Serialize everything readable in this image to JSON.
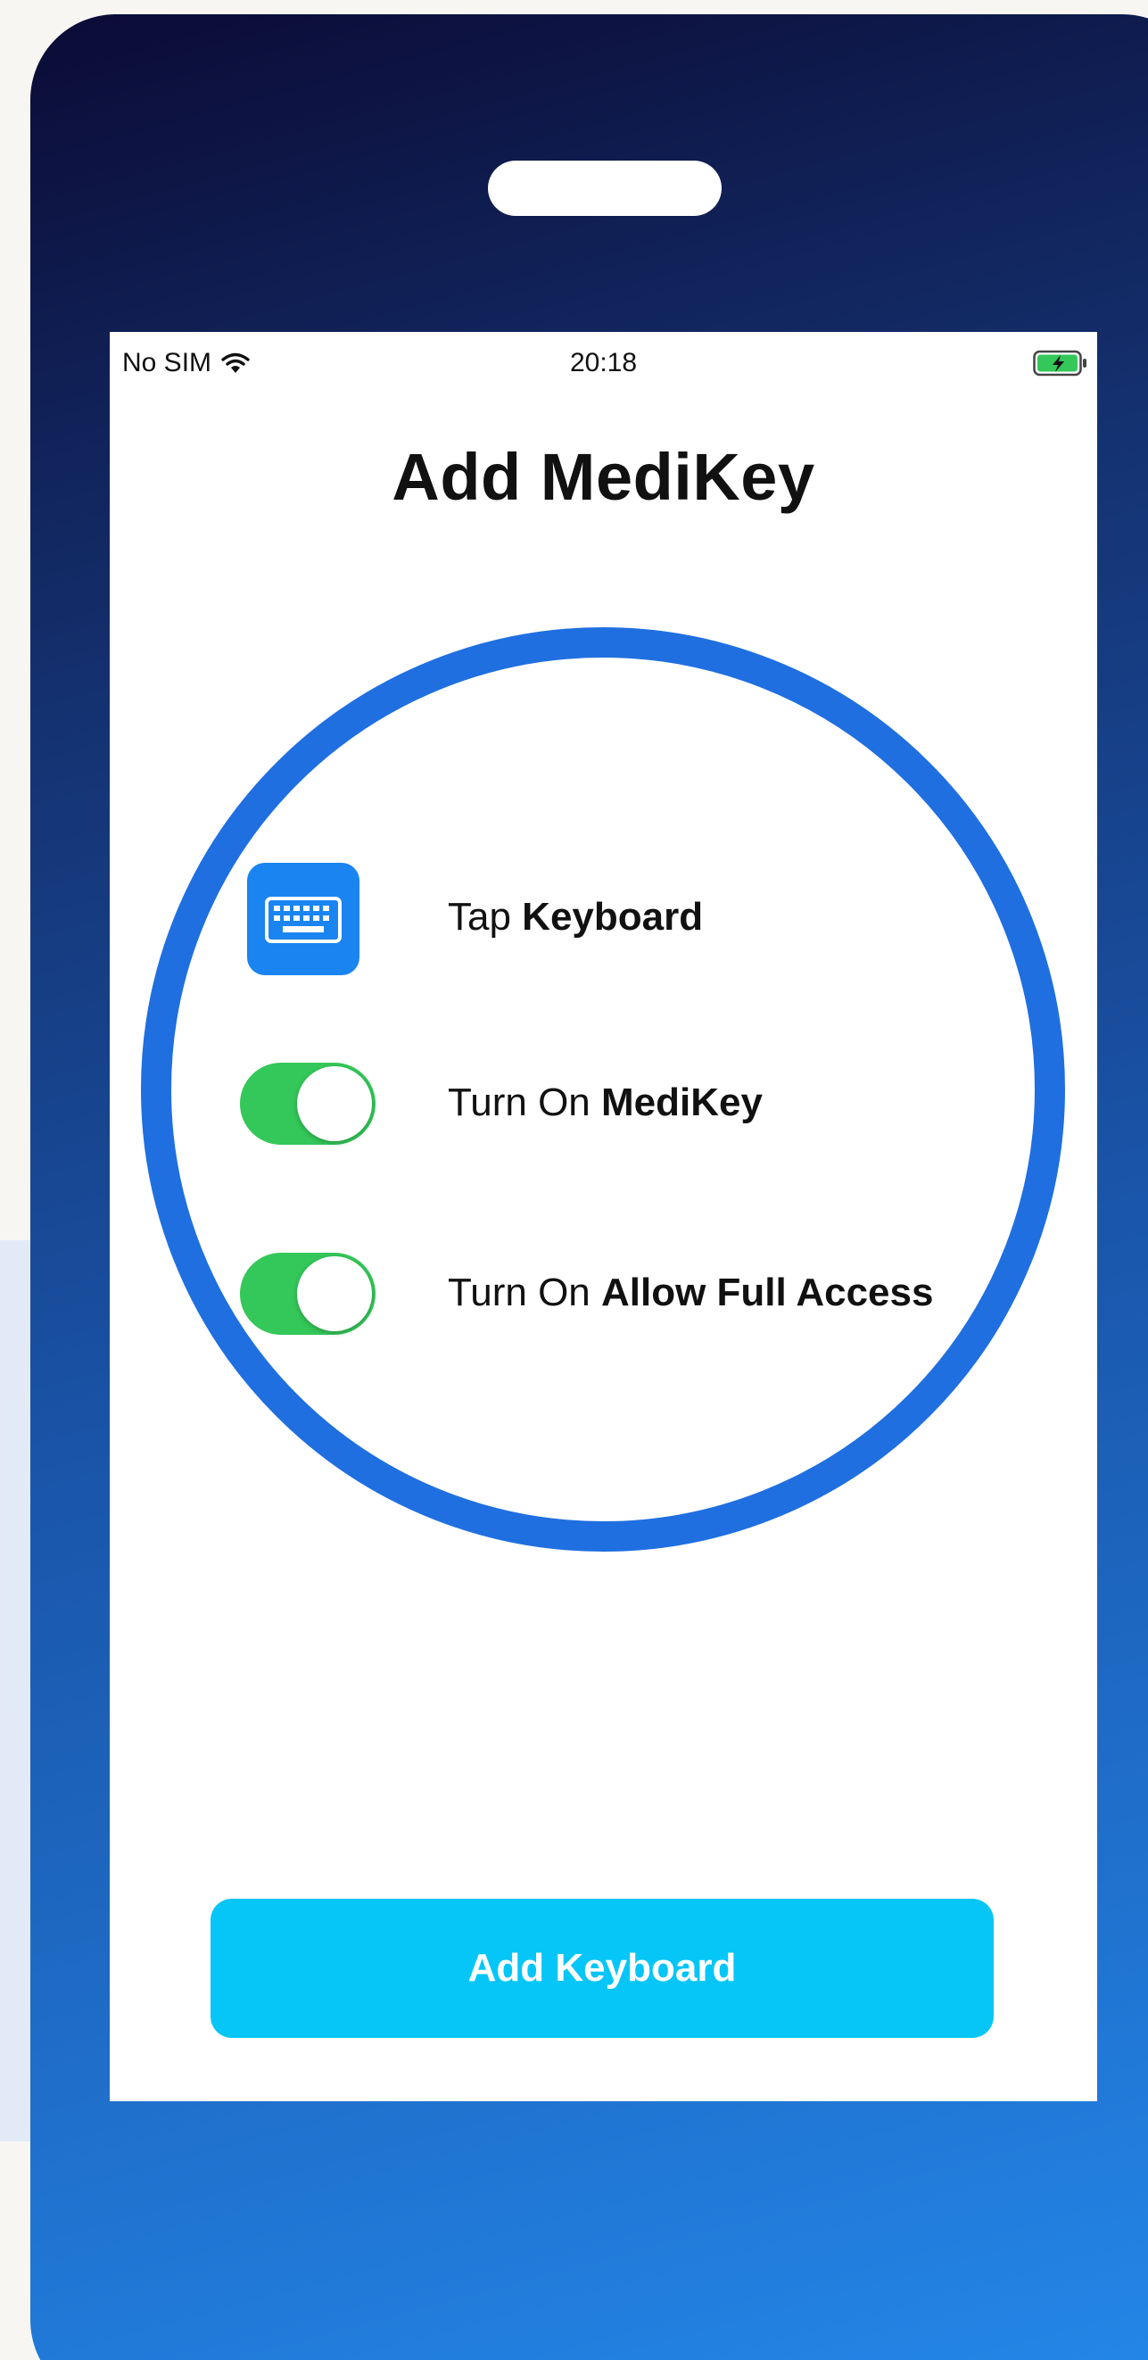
{
  "status_bar": {
    "carrier": "No SIM",
    "time": "20:18"
  },
  "screen": {
    "title": "Add MediKey"
  },
  "steps": [
    {
      "prefix": "Tap ",
      "emphasis": "Keyboard",
      "icon": "keyboard-icon"
    },
    {
      "prefix": "Turn On ",
      "emphasis": "MediKey",
      "toggle_on": true
    },
    {
      "prefix": "Turn On ",
      "emphasis": "Allow Full Access",
      "toggle_on": true
    }
  ],
  "button": {
    "label": "Add Keyboard"
  },
  "colors": {
    "ring": "#1f6fe0",
    "toggle_on": "#34c759",
    "button": "#06c6f7",
    "keyboard_icon_bg": "#1a84f0"
  }
}
